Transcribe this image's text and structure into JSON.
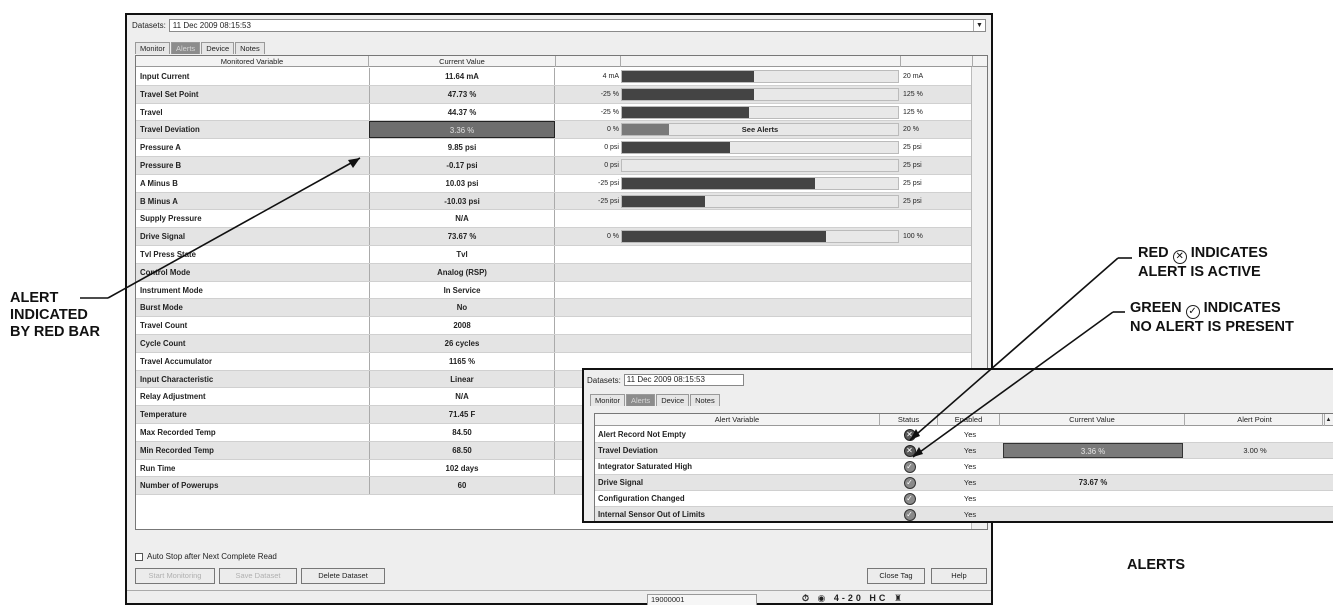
{
  "main": {
    "datasets_label": "Datasets:",
    "dataset_value": "11 Dec 2009 08:15:53",
    "tabs": [
      {
        "label": "Monitor"
      },
      {
        "label": "Alerts"
      },
      {
        "label": "Device"
      },
      {
        "label": "Notes"
      }
    ],
    "columns": {
      "variable": "Monitored Variable",
      "value": "Current Value"
    },
    "rows": [
      {
        "name": "Input Current",
        "value": "11.64 mA",
        "min": "4 mA",
        "max": "20 mA",
        "fraction": 0.48
      },
      {
        "name": "Travel Set Point",
        "value": "47.73 %",
        "min": "-25 %",
        "max": "125 %",
        "fraction": 0.48
      },
      {
        "name": "Travel",
        "value": "44.37 %",
        "min": "-25 %",
        "max": "125 %",
        "fraction": 0.46
      },
      {
        "name": "Travel Deviation",
        "value": "3.36 %",
        "min": "0 %",
        "max": "20 %",
        "fraction": 0.17,
        "alert": true,
        "note": "See Alerts"
      },
      {
        "name": "Pressure A",
        "value": "9.85 psi",
        "min": "0 psi",
        "max": "25 psi",
        "fraction": 0.39
      },
      {
        "name": "Pressure B",
        "value": "-0.17 psi",
        "min": "0 psi",
        "max": "25 psi",
        "fraction": 0.0
      },
      {
        "name": "A Minus B",
        "value": "10.03 psi",
        "min": "-25 psi",
        "max": "25 psi",
        "fraction": 0.7
      },
      {
        "name": "B Minus A",
        "value": "-10.03 psi",
        "min": "-25 psi",
        "max": "25 psi",
        "fraction": 0.3
      },
      {
        "name": "Supply Pressure",
        "value": "N/A",
        "min": "",
        "max": ""
      },
      {
        "name": "Drive Signal",
        "value": "73.67 %",
        "min": "0 %",
        "max": "100 %",
        "fraction": 0.74
      },
      {
        "name": "Tvl Press State",
        "value": "Tvl"
      },
      {
        "name": "Control Mode",
        "value": "Analog (RSP)"
      },
      {
        "name": "Instrument Mode",
        "value": "In Service"
      },
      {
        "name": "Burst Mode",
        "value": "No"
      },
      {
        "name": "Travel Count",
        "value": "2008"
      },
      {
        "name": "Cycle Count",
        "value": "26 cycles"
      },
      {
        "name": "Travel Accumulator",
        "value": "1165 %"
      },
      {
        "name": "Input Characteristic",
        "value": "Linear"
      },
      {
        "name": "Relay Adjustment",
        "value": "N/A"
      },
      {
        "name": "Temperature",
        "value": "71.45 F"
      },
      {
        "name": "Max Recorded Temp",
        "value": "84.50"
      },
      {
        "name": "Min Recorded Temp",
        "value": "68.50"
      },
      {
        "name": "Run Time",
        "value": "102 days"
      },
      {
        "name": "Number of Powerups",
        "value": "60"
      }
    ],
    "auto_stop_label": "Auto Stop after Next Complete Read",
    "buttons": {
      "start": "Start Monitoring",
      "save": "Save Dataset",
      "delete": "Delete Dataset",
      "close": "Close Tag",
      "help": "Help"
    },
    "status_field": "19000001",
    "status_icons_text": "4-20  HC"
  },
  "alerts": {
    "datasets_label": "Datasets:",
    "dataset_value": "11 Dec 2009 08:15:53",
    "tabs": [
      {
        "label": "Monitor"
      },
      {
        "label": "Alerts"
      },
      {
        "label": "Device"
      },
      {
        "label": "Notes"
      }
    ],
    "columns": {
      "variable": "Alert Variable",
      "status": "Status",
      "enabled": "Enabled",
      "value": "Current Value",
      "point": "Alert Point"
    },
    "rows": [
      {
        "name": "Alert Record Not Empty",
        "status": "red",
        "enabled": "Yes",
        "value": "",
        "point": ""
      },
      {
        "name": "Travel Deviation",
        "status": "red",
        "enabled": "Yes",
        "value": "3.36 %",
        "point": "3.00 %",
        "alert": true
      },
      {
        "name": "Integrator Saturated High",
        "status": "green",
        "enabled": "Yes",
        "value": "",
        "point": ""
      },
      {
        "name": "Drive Signal",
        "status": "green",
        "enabled": "Yes",
        "value": "73.67 %",
        "point": ""
      },
      {
        "name": "Configuration Changed",
        "status": "green",
        "enabled": "Yes",
        "value": "",
        "point": ""
      },
      {
        "name": "Internal Sensor Out of Limits",
        "status": "green",
        "enabled": "Yes",
        "value": "",
        "point": ""
      }
    ]
  },
  "callouts": {
    "alert_bar": [
      "ALERT",
      "INDICATED",
      "BY RED BAR"
    ],
    "red_line1_pre": "RED",
    "red_line1_post": "INDICATES",
    "red_line2": "ALERT IS ACTIVE",
    "green_line1_pre": "GREEN",
    "green_line1_post": "INDICATES",
    "green_line2": "NO ALERT IS PRESENT",
    "alerts_caption": "ALERTS"
  },
  "icons": {
    "red_status": "x-circle-icon",
    "green_status": "check-circle-icon"
  }
}
